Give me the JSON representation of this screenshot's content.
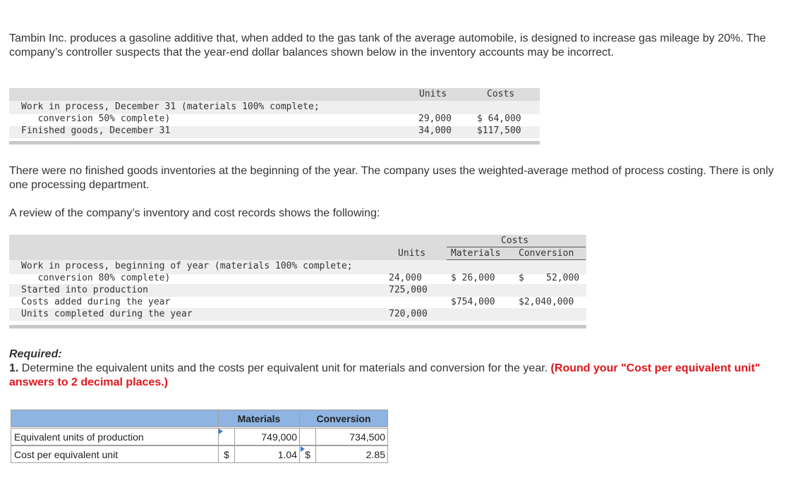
{
  "intro": {
    "p1": "Tambin Inc. produces a gasoline additive that, when added to the gas tank of the average automobile, is designed to increase gas mileage by 20%. The company’s controller suspects that the year-end dollar balances shown below in the inventory accounts may be incorrect.",
    "p2": "There were no finished goods inventories at the beginning of the year. The company uses the weighted-average method of process costing. There is only one processing department.",
    "p3": "A review of the company’s inventory and cost records shows the following:"
  },
  "table1": {
    "headers": {
      "units": "Units",
      "costs": "Costs"
    },
    "rows": [
      {
        "label": "Work in process, December 31 (materials 100% complete;",
        "units": "",
        "costs": ""
      },
      {
        "label": "   conversion 50% complete)",
        "units": "29,000",
        "costs": "$ 64,000"
      },
      {
        "label": "Finished goods, December 31",
        "units": "34,000",
        "costs": "$117,500"
      }
    ]
  },
  "table2": {
    "headers": {
      "costs": "Costs",
      "units": "Units",
      "materials": "Materials",
      "conversion": "Conversion"
    },
    "rows": [
      {
        "label": "Work in process, beginning of year (materials 100% complete;",
        "units": "",
        "materials": "",
        "conversion": ""
      },
      {
        "label": "   conversion 80% complete)",
        "units": "24,000",
        "materials": "$ 26,000",
        "conversion": "$    52,000"
      },
      {
        "label": "Started into production",
        "units": "725,000",
        "materials": "",
        "conversion": ""
      },
      {
        "label": "Costs added during the year",
        "units": "",
        "materials": "$754,000",
        "conversion": "$2,040,000"
      },
      {
        "label": "Units completed during the year",
        "units": "720,000",
        "materials": "",
        "conversion": ""
      }
    ]
  },
  "required": {
    "heading": "Required:",
    "q1_number": "1.",
    "q1_text": " Determine the equivalent units and the costs per equivalent unit for materials and conversion for the year.",
    "q1_note": " (Round your \"Cost per equivalent unit\" answers to 2 decimal places.)"
  },
  "answer_table": {
    "headers": {
      "materials": "Materials",
      "conversion": "Conversion"
    },
    "rows": [
      {
        "label": "Equivalent units of production",
        "materials_prefix": "",
        "materials": "749,000",
        "conversion_prefix": "",
        "conversion": "734,500"
      },
      {
        "label": "Cost per equivalent unit",
        "materials_prefix": "$",
        "materials": "1.04",
        "conversion_prefix": "$",
        "conversion": "2.85"
      }
    ],
    "header_color": "#8db4e2",
    "flag_color": "#3a7bd5",
    "note_color": "#e0161b"
  }
}
